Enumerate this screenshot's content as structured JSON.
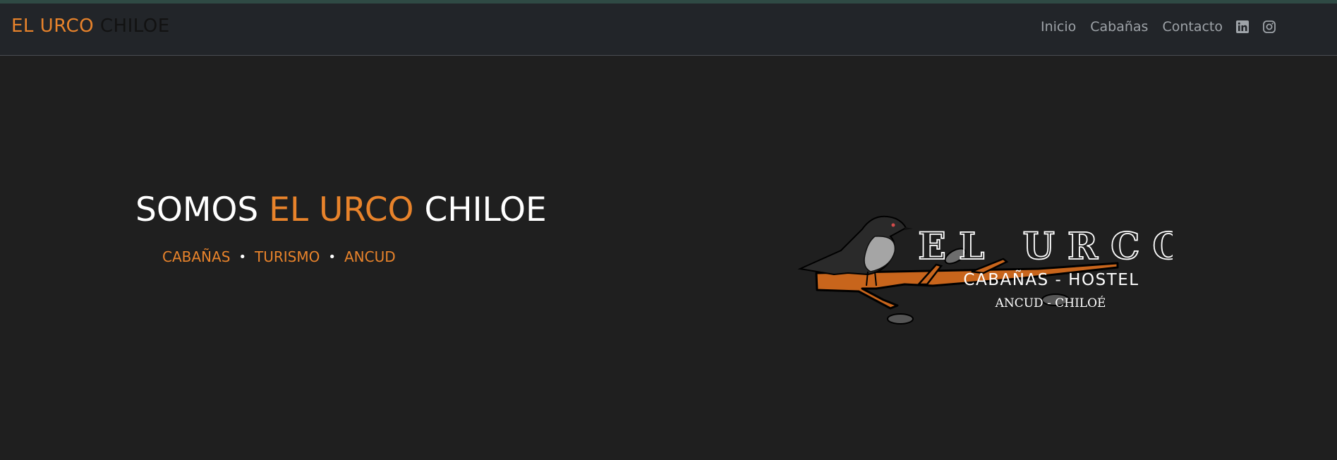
{
  "navbar": {
    "brand_part1": "EL URCO",
    "brand_part2": "CHILOE",
    "links": [
      "Inicio",
      "Cabañas",
      "Contacto"
    ],
    "social_icons": [
      "linkedin-icon",
      "instagram-icon"
    ]
  },
  "hero": {
    "headline_pre": "SOMOS ",
    "headline_accent": "EL URCO",
    "headline_post": " CHILOE",
    "tags": [
      "CABAÑAS",
      "TURISMO",
      "ANCUD"
    ],
    "dot": "•"
  },
  "logo": {
    "title": "EL URCO",
    "subtitle": "CABAÑAS - HOSTEL",
    "location": "ANCUD - CHILOÉ"
  },
  "colors": {
    "accent": "#e8832b",
    "background": "#1f1f1f",
    "navbar": "#222529",
    "nav_link": "#9ea3a8"
  }
}
